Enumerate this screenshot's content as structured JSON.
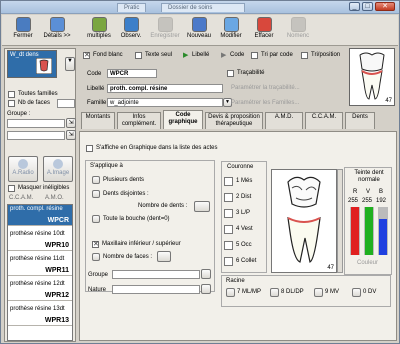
{
  "window": {
    "tabs": [
      "Pratic",
      "Dossier de soins"
    ],
    "buttons": [
      "_",
      "□",
      "✕"
    ]
  },
  "toolbar": [
    {
      "label": "Fermer",
      "icon": "door-close-icon",
      "enabled": true,
      "color": "#4a7cc0"
    },
    {
      "label": "Détails >>",
      "icon": "details-icon",
      "enabled": true,
      "color": "#5b8fd6"
    },
    {
      "label": "multiples",
      "icon": "multiple-icon",
      "enabled": true,
      "color": "#7aa640"
    },
    {
      "label": "Observ.",
      "icon": "observation-icon",
      "enabled": true,
      "color": "#3c7fc9"
    },
    {
      "label": "Enregistrer",
      "icon": "save-icon",
      "enabled": false,
      "color": "#8c8c8c"
    },
    {
      "label": "Nouveau",
      "icon": "new-icon",
      "enabled": true,
      "color": "#4b79c9"
    },
    {
      "label": "Modifier",
      "icon": "edit-icon",
      "enabled": true,
      "color": "#6aa7e3"
    },
    {
      "label": "Effacer",
      "icon": "erase-icon",
      "enabled": true,
      "color": "#d8483c"
    },
    {
      "label": "Nomenc",
      "icon": "nomenclature-icon",
      "enabled": false,
      "color": "#8c8c8c"
    }
  ],
  "left": {
    "code_box": "W_dt dens",
    "toutes_familles": "Toutes familles",
    "nb_faces": "Nb de faces",
    "groupe_label": "Groupe :",
    "radio_label": "A.Radio",
    "image_label": "A.Image",
    "masquer": "Masquer inéligibles",
    "col_headers": [
      "C.C.A.M.",
      "A.M.O."
    ],
    "items": [
      {
        "desc": "proth. compl. résine",
        "code": "WPCR",
        "selected": true
      },
      {
        "desc": "prothèse résine 10dt",
        "code": "WPR10",
        "selected": false
      },
      {
        "desc": "prothèse résine 11dt",
        "code": "WPR11",
        "selected": false
      },
      {
        "desc": "prothèse résine 12dt",
        "code": "WPR12",
        "selected": false
      },
      {
        "desc": "prothèse résine 13dt",
        "code": "WPR13",
        "selected": false
      }
    ]
  },
  "options": {
    "fond_blanc": "Fond blanc",
    "texte_seul": "Texte seul",
    "libelle": "Libellé",
    "code": "Code",
    "tri_par_code": "Tri par code",
    "tri_position": "Tri/position"
  },
  "form": {
    "code_label": "Code",
    "code_value": "WPCR",
    "libelle_label": "Libellé",
    "libelle_value": "proth. compl. résine",
    "famille_label": "Famille",
    "famille_value": "w_adjointe",
    "tracabilite": "Traçabilité",
    "param_tracabilite": "Paramétrer la traçabilité...",
    "param_familles": "Paramétrer les Familles...",
    "tooth_number": "47"
  },
  "tabs": [
    "Montants",
    "Infos complément.",
    "Code graphique",
    "Devis & proposition thérapeutique",
    "A.M.D.",
    "C.C.A.M.",
    "Dents"
  ],
  "active_tab": "Code graphique",
  "graphique": {
    "affiche": "S'affiche en Graphique dans la liste des actes",
    "applique": "S'applique à",
    "plusieurs_dents": "Plusieurs dents",
    "dents_disjointes": "Dents disjointes :",
    "nombre_dents": "Nombre de dents :",
    "toute_bouche": "Toute la bouche (dent=0)",
    "maxillaire": "Maxillaire inférieur / supérieur",
    "nombre_faces": "Nombre de faces :",
    "groupe": "Groupe",
    "nature": "Nature",
    "couronne_title": "Couronne",
    "couronne": [
      "Més",
      "Dist",
      "L/P",
      "Vest",
      "Occ",
      "Collet"
    ],
    "couronne_nums": [
      "1",
      "2",
      "3",
      "4",
      "5",
      "6"
    ],
    "racine_title": "Racine",
    "racine": [
      {
        "num": "7",
        "label": "ML/MP"
      },
      {
        "num": "8",
        "label": "DL/DP"
      },
      {
        "num": "9",
        "label": "MV"
      },
      {
        "num": "0",
        "label": "DV"
      }
    ],
    "big_tooth_number": "47",
    "teinte_title": "Teinte dent normale",
    "rvb_labels": [
      "R",
      "V",
      "B"
    ],
    "rvb_values": [
      "255",
      "255",
      "192"
    ],
    "rvb_levels": [
      1.0,
      1.0,
      0.75
    ],
    "couleur_label": "Couleur"
  }
}
